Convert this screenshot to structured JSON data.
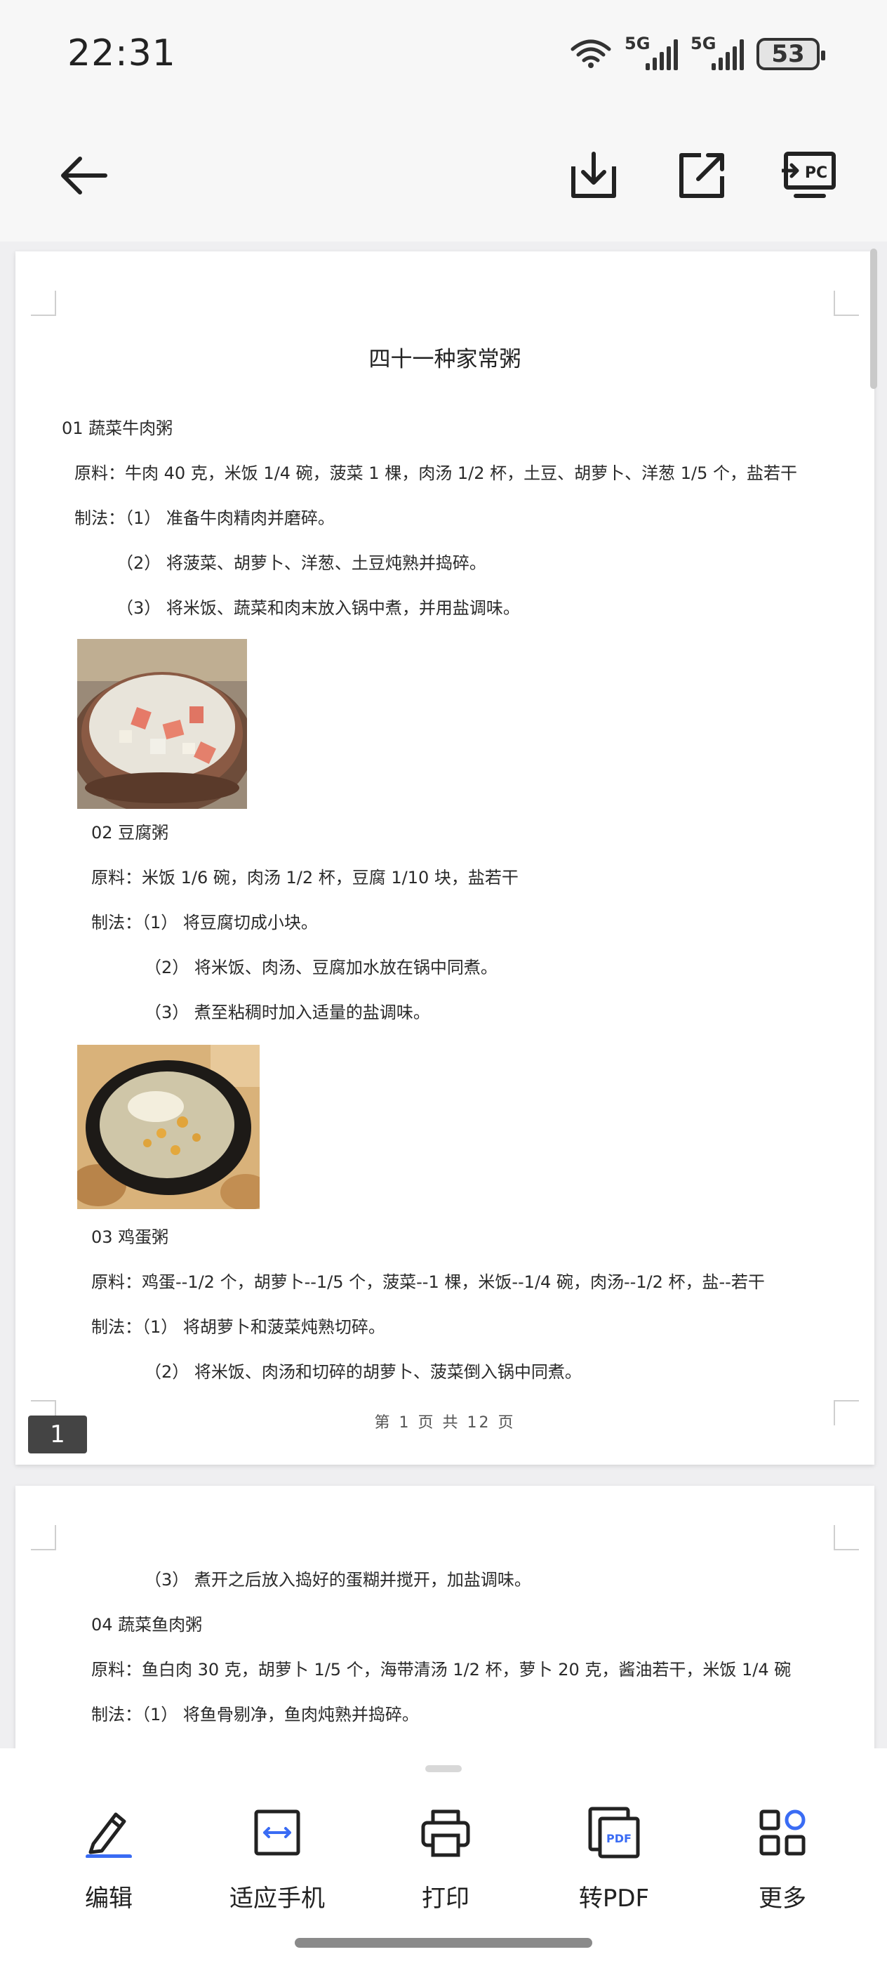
{
  "status_bar": {
    "time": "22:31",
    "network_1": "5G",
    "network_2": "5G",
    "battery": "53",
    "icons": [
      "wifi-icon",
      "signal-icon",
      "signal-icon",
      "battery-icon"
    ]
  },
  "toolbar": {
    "icons": [
      "back-arrow-icon",
      "download-icon",
      "share-icon",
      "to-pc-icon"
    ],
    "pc_label": "PC"
  },
  "document": {
    "title": "四十一种家常粥",
    "page1": {
      "lines": [
        "01 蔬菜牛肉粥",
        "原料：牛肉 40 克，米饭 1/4 碗，菠菜 1 棵，肉汤 1/2 杯，土豆、胡萝卜、洋葱 1/5 个，盐若干",
        "制法：（1） 准备牛肉精肉并磨碎。",
        "（2） 将菠菜、胡萝卜、洋葱、土豆炖熟并捣碎。",
        "（3） 将米饭、蔬菜和肉末放入锅中煮，并用盐调味。",
        "02 豆腐粥",
        "原料：米饭 1/6 碗，肉汤 1/2 杯，豆腐 1/10 块，盐若干",
        "制法：（1） 将豆腐切成小块。",
        "（2） 将米饭、肉汤、豆腐加水放在锅中同煮。",
        "（3） 煮至粘稠时加入适量的盐调味。",
        "03 鸡蛋粥",
        "原料：鸡蛋--1/2 个，胡萝卜--1/5 个，菠菜--1 棵，米饭--1/4 碗，肉汤--1/2 杯，盐--若干",
        "制法：（1） 将胡萝卜和菠菜炖熟切碎。",
        "（2） 将米饭、肉汤和切碎的胡萝卜、菠菜倒入锅中同煮。"
      ],
      "footer": "第 1 页 共 12 页",
      "badge": "1"
    },
    "page2": {
      "lines": [
        "（3） 煮开之后放入捣好的蛋糊并搅开，加盐调味。",
        "04 蔬菜鱼肉粥",
        "原料：鱼白肉 30 克，胡萝卜 1/5 个，海带清汤 1/2 杯，萝卜 20 克，酱油若干，米饭 1/4 碗",
        "制法：（1） 将鱼骨剔净，鱼肉炖熟并捣碎。"
      ]
    }
  },
  "bottom_actions": [
    {
      "label": "编辑",
      "icon": "edit-pen-icon"
    },
    {
      "label": "适应手机",
      "icon": "fit-phone-icon"
    },
    {
      "label": "打印",
      "icon": "print-icon"
    },
    {
      "label": "转PDF",
      "icon": "to-pdf-icon"
    },
    {
      "label": "更多",
      "icon": "more-grid-icon"
    }
  ],
  "pdf_badge": "PDF",
  "colors": {
    "accent": "#3a6cf4",
    "icon": "#222222"
  }
}
